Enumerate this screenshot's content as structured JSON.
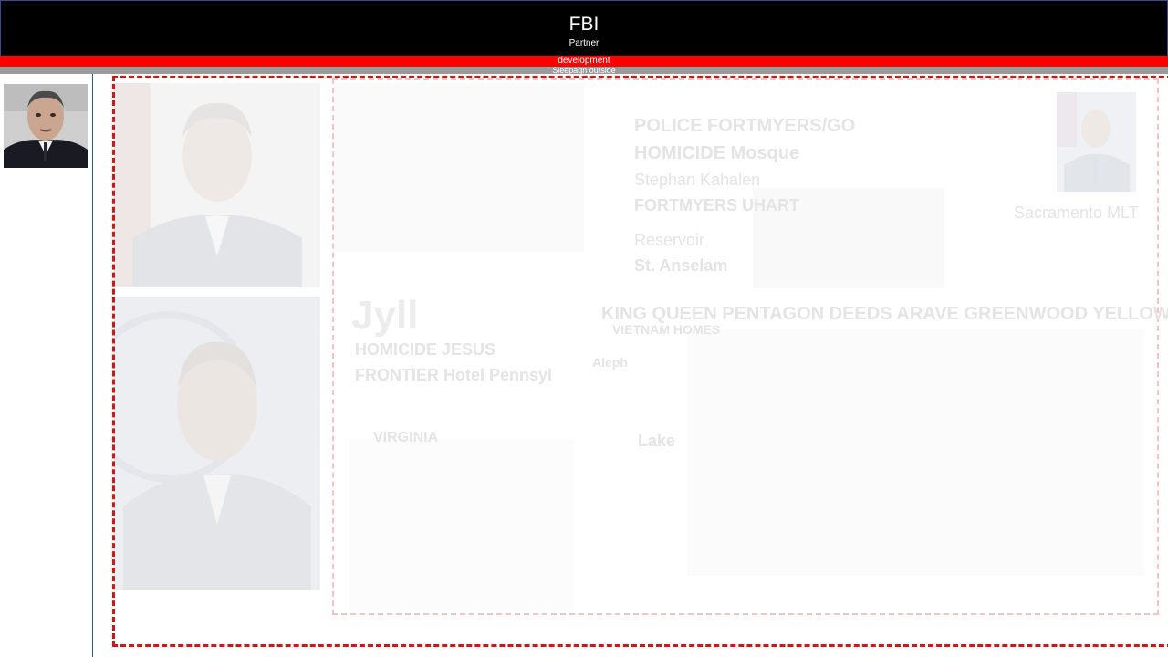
{
  "header": {
    "title": "FBI",
    "subtitle": "Partner"
  },
  "bars": {
    "red_label": "development",
    "gray_label": "Sleepagn outside"
  },
  "canvas": {
    "ghost_text": [
      "POLICE FORTMYERS/GO",
      "HOMICIDE Mosque",
      "Stephan Kahalen",
      "FORTMYERS UHART",
      "Reservoir",
      "St. Anselam",
      "Jyll",
      "HOMICIDE JESUS",
      "FRONTIER Hotel Pennsyl",
      "KING QUEEN PENTAGON DEEDS ARAVE GREENWOOD YELLOW",
      "VIETNAM HOMES",
      "Aleph",
      "VIRGINIA",
      "Lake",
      "Sacramento MLT"
    ]
  },
  "colors": {
    "header_bg": "#000000",
    "accent_red": "#ff0000",
    "divider_gray": "#9a9a9a",
    "dashed_border": "#d01616",
    "inner_dashed": "#f3c2c2"
  }
}
